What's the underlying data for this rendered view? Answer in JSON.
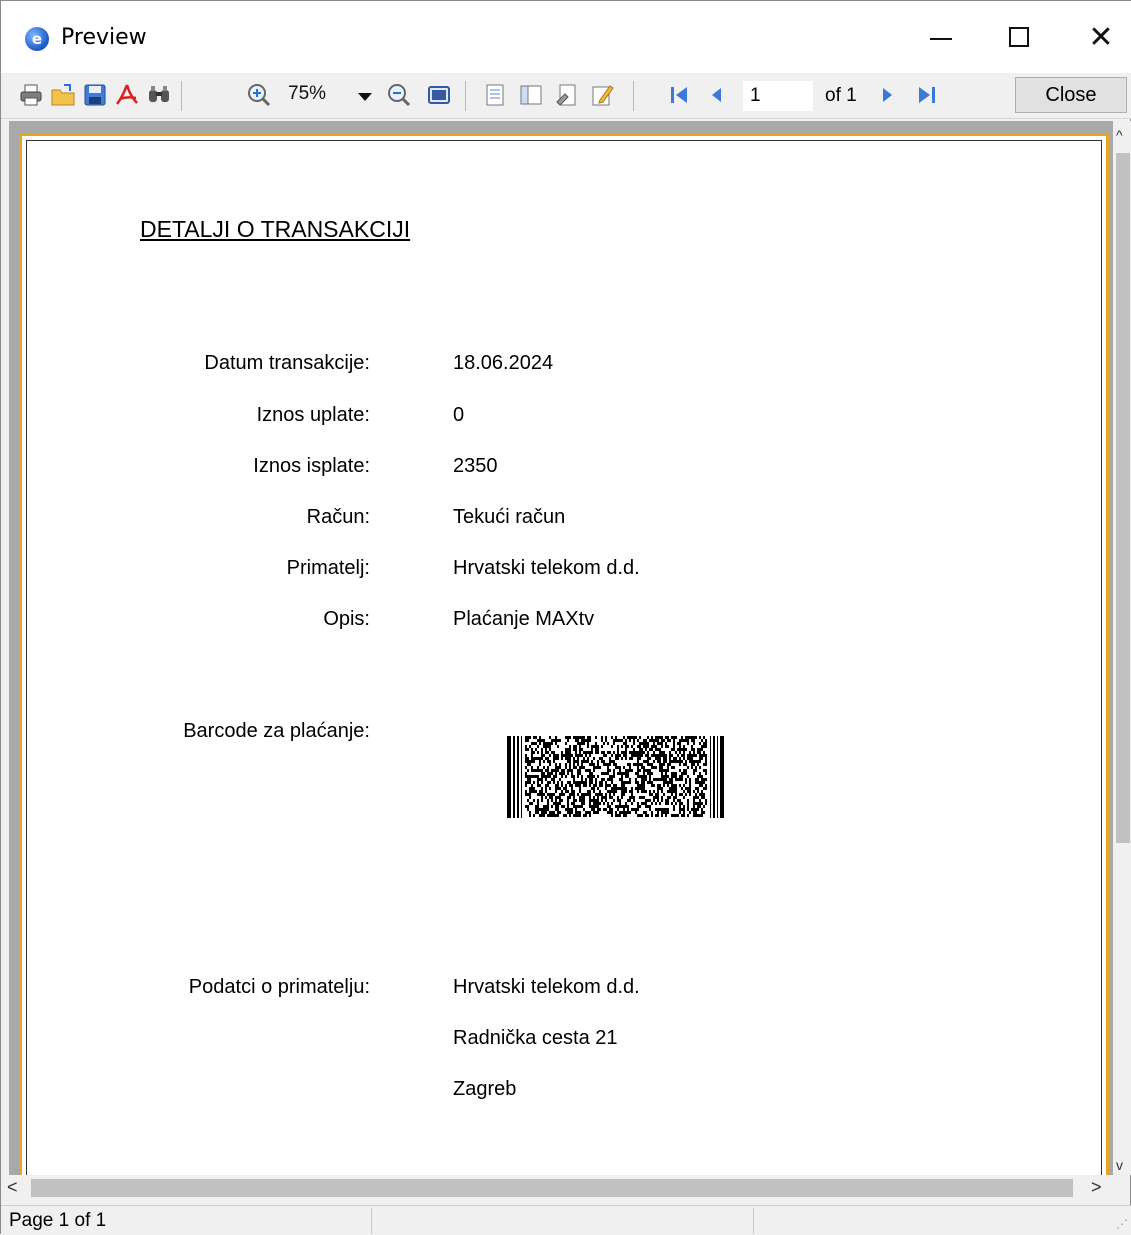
{
  "window": {
    "title": "Preview",
    "app_icon_glyph": "e",
    "controls": {
      "minimize": "minimize",
      "maximize": "maximize",
      "close": "✕"
    }
  },
  "toolbar": {
    "zoom": "75%",
    "page_number": "1",
    "page_of": "of 1",
    "close_label": "Close",
    "icons": [
      "print-icon",
      "open-icon",
      "save-icon",
      "pdf-icon",
      "find-icon",
      "zoom-in-icon",
      "zoom-out-icon",
      "page-view-icon",
      "thumbnails-icon",
      "outline-icon",
      "page-setup-icon",
      "edit-icon",
      "first-page-icon",
      "prev-page-icon",
      "next-page-icon",
      "last-page-icon"
    ]
  },
  "document": {
    "title": "DETALJI O TRANSAKCIJI",
    "fields": [
      {
        "label": "Datum transakcije:",
        "value": "18.06.2024"
      },
      {
        "label": "Iznos uplate:",
        "value": "0"
      },
      {
        "label": "Iznos isplate:",
        "value": "2350"
      },
      {
        "label": "Račun:",
        "value": "Tekući račun"
      },
      {
        "label": "Primatelj:",
        "value": "Hrvatski telekom d.d."
      },
      {
        "label": "Opis:",
        "value": "Plaćanje MAXtv"
      }
    ],
    "barcode_label": "Barcode za plaćanje:",
    "recipient_label": "Podatci o primatelju:",
    "recipient_lines": [
      "Hrvatski telekom d.d.",
      "Radnička cesta 21",
      "Zagreb"
    ]
  },
  "status": {
    "text": "Page 1 of 1"
  },
  "colors": {
    "page_border": "#e6a523",
    "preview_bg": "#a9a9a9"
  }
}
